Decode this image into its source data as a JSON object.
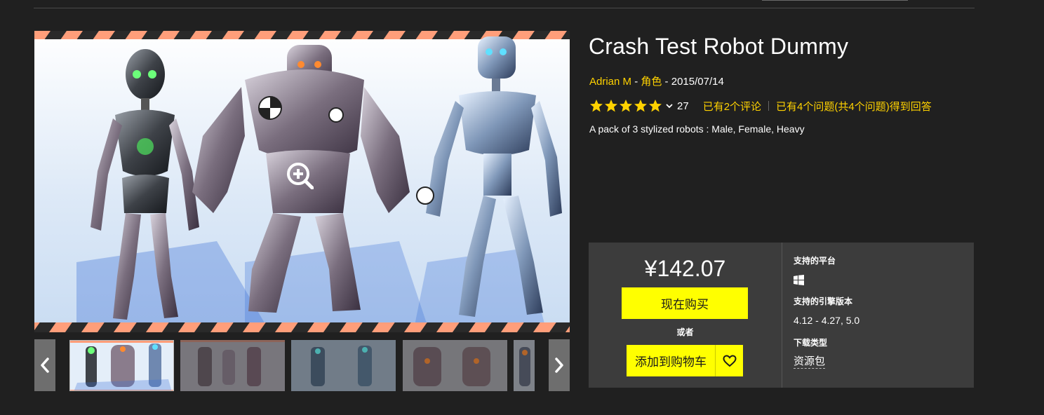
{
  "product": {
    "title": "Crash Test Robot Dummy",
    "author": "Adrian M",
    "separator": " - ",
    "category": "角色",
    "date": "2015/07/14",
    "rating_stars": 5,
    "rating_count": "27",
    "reviews_link": "已有2个评论",
    "questions_link": "已有4个问题(共4个问题)得到回答",
    "description": "A pack of 3 stylized robots : Male, Female, Heavy"
  },
  "purchase": {
    "price": "¥142.07",
    "buy_label": "现在购买",
    "or_label": "或者",
    "add_to_cart_label": "添加到购物车",
    "platforms_label": "支持的平台",
    "engine_label": "支持的引擎版本",
    "engine_versions": "4.12 - 4.27, 5.0",
    "download_label": "下载类型",
    "download_type": "资源包"
  },
  "gallery": {
    "thumbnail_count": 5,
    "selected_index": 0
  },
  "icons": {
    "zoom": "zoom-in-icon",
    "prev": "chevron-left-icon",
    "next": "chevron-right-icon",
    "wishlist": "heart-icon",
    "platform": "windows-icon",
    "rating_dropdown": "chevron-down-icon"
  },
  "colors": {
    "accent": "#ffd200",
    "button": "#ffff00",
    "background": "#202020",
    "panel": "#3c3c3c"
  }
}
